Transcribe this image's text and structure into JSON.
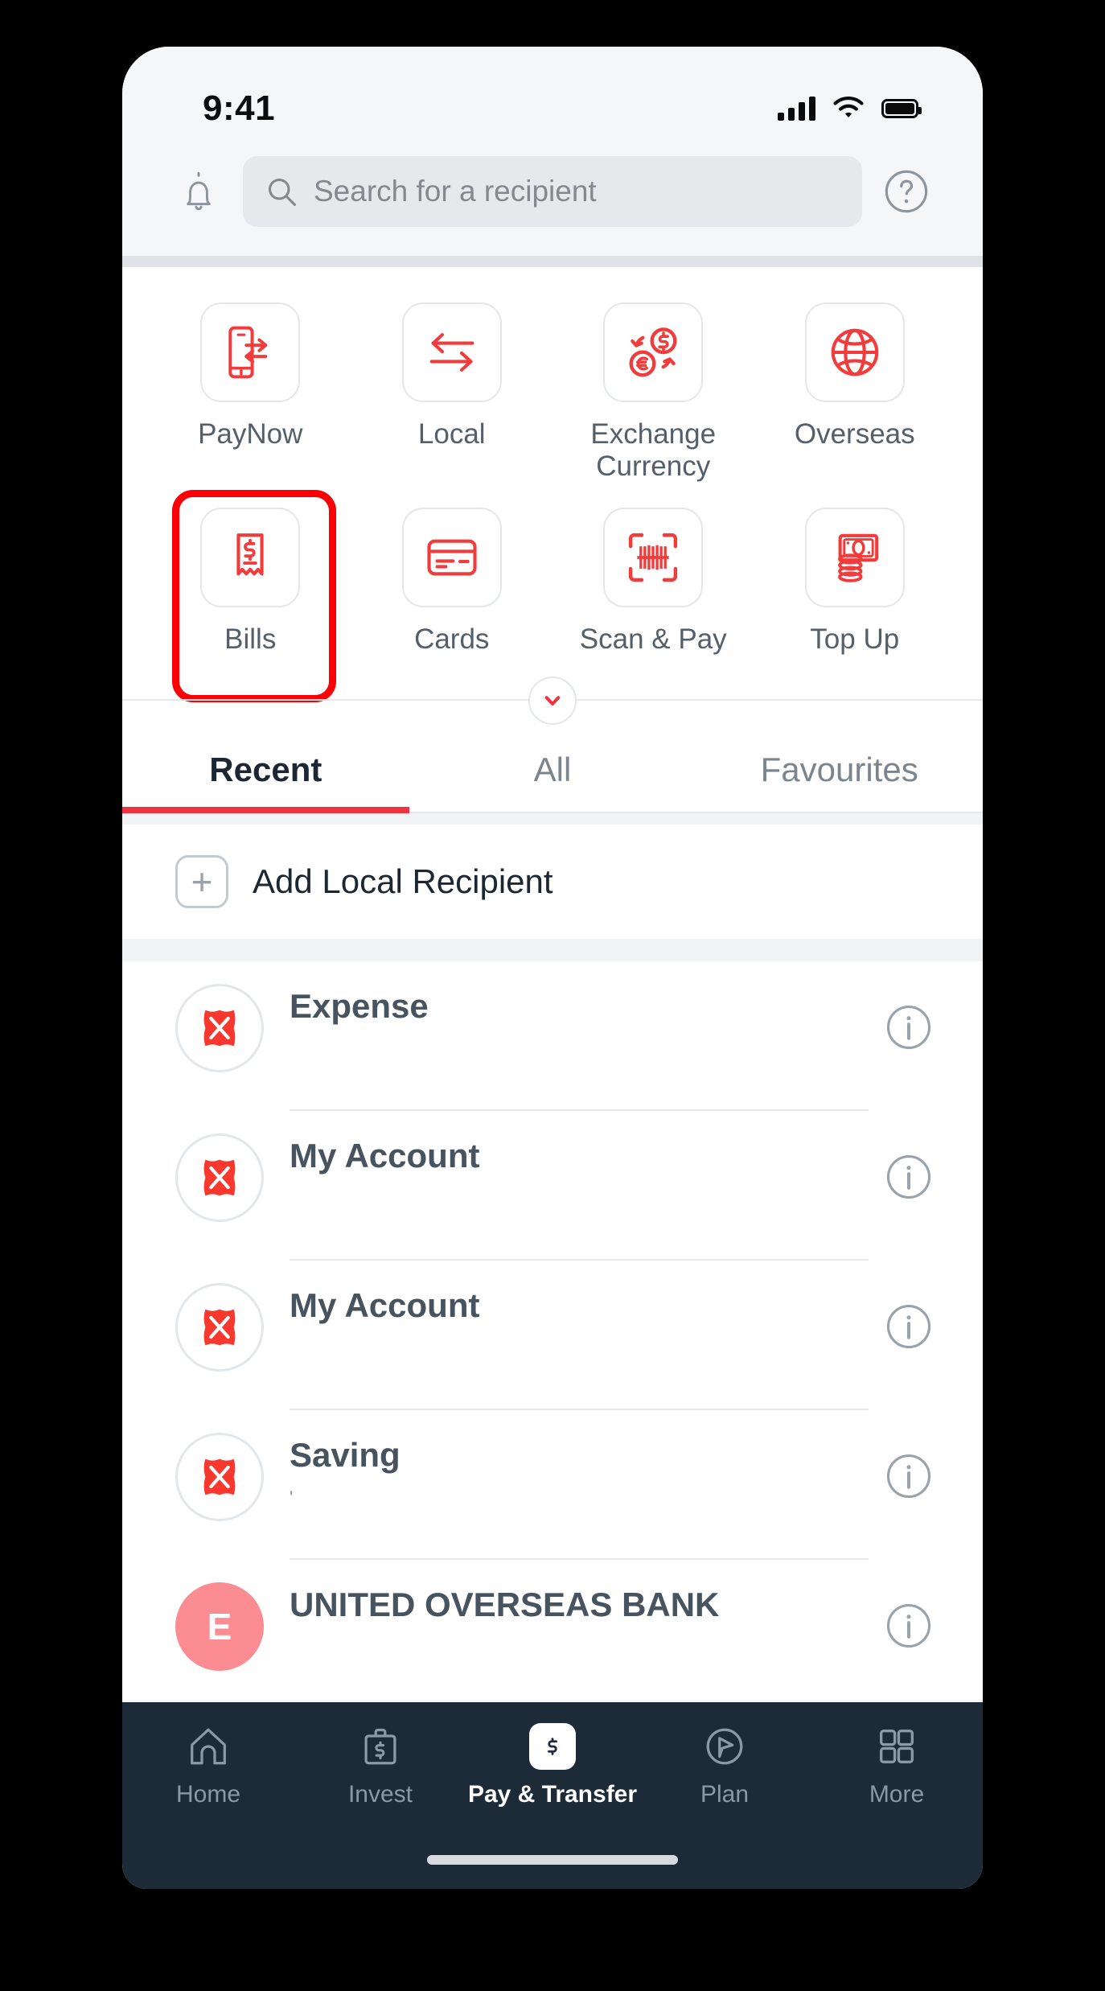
{
  "status_bar": {
    "time": "9:41",
    "icons": [
      "cellular-signal-icon",
      "wifi-icon",
      "battery-icon"
    ]
  },
  "header": {
    "bell_icon": "notification-bell-icon",
    "help_icon": "help-circle-icon",
    "search": {
      "icon": "search-icon",
      "placeholder": "Search for a recipient",
      "value": ""
    }
  },
  "actions": {
    "row1": [
      {
        "label": "PayNow",
        "icon": "paynow-phone-transfer-icon"
      },
      {
        "label": "Local",
        "icon": "local-transfer-arrows-icon"
      },
      {
        "label": "Exchange Currency",
        "icon": "exchange-currency-icon"
      },
      {
        "label": "Overseas",
        "icon": "globe-icon"
      }
    ],
    "row2": [
      {
        "label": "Bills",
        "icon": "bill-receipt-icon",
        "highlighted": true
      },
      {
        "label": "Cards",
        "icon": "credit-card-icon",
        "highlighted": false
      },
      {
        "label": "Scan & Pay",
        "icon": "barcode-scan-icon",
        "highlighted": false
      },
      {
        "label": "Top Up",
        "icon": "banknote-coins-icon",
        "highlighted": false
      }
    ],
    "expand_icon": "chevron-down-icon"
  },
  "tabs": [
    {
      "label": "Recent",
      "active": true
    },
    {
      "label": "All",
      "active": false
    },
    {
      "label": "Favourites",
      "active": false
    }
  ],
  "add_recipient": {
    "icon": "plus-icon",
    "label": "Add Local Recipient"
  },
  "recipients": [
    {
      "name": "Expense",
      "sub": "",
      "avatar_type": "logo",
      "avatar_text": "",
      "info_icon": "info-icon"
    },
    {
      "name": "My Account",
      "sub": "",
      "avatar_type": "logo",
      "avatar_text": "",
      "info_icon": "info-icon"
    },
    {
      "name": "My Account",
      "sub": "",
      "avatar_type": "logo",
      "avatar_text": "",
      "info_icon": "info-icon"
    },
    {
      "name": "Saving",
      "sub": "'",
      "avatar_type": "logo",
      "avatar_text": "",
      "info_icon": "info-icon"
    },
    {
      "name": "UNITED OVERSEAS BANK",
      "sub": "",
      "avatar_type": "initial",
      "avatar_text": "E",
      "info_icon": "info-icon"
    }
  ],
  "bottom_nav": [
    {
      "label": "Home",
      "icon": "home-icon",
      "active": false
    },
    {
      "label": "Invest",
      "icon": "briefcase-dollar-icon",
      "active": false
    },
    {
      "label": "Pay & Transfer",
      "icon": "dollar-tag-icon",
      "active": true
    },
    {
      "label": "Plan",
      "icon": "compass-icon",
      "active": false
    },
    {
      "label": "More",
      "icon": "grid-menu-icon",
      "active": false
    }
  ],
  "colors": {
    "brand_red": "#ef3340",
    "highlight_red": "#fb0007",
    "nav_dark": "#1d2a38",
    "header_bg": "#f4f6f8",
    "avatar_pink": "#fb8c92"
  }
}
